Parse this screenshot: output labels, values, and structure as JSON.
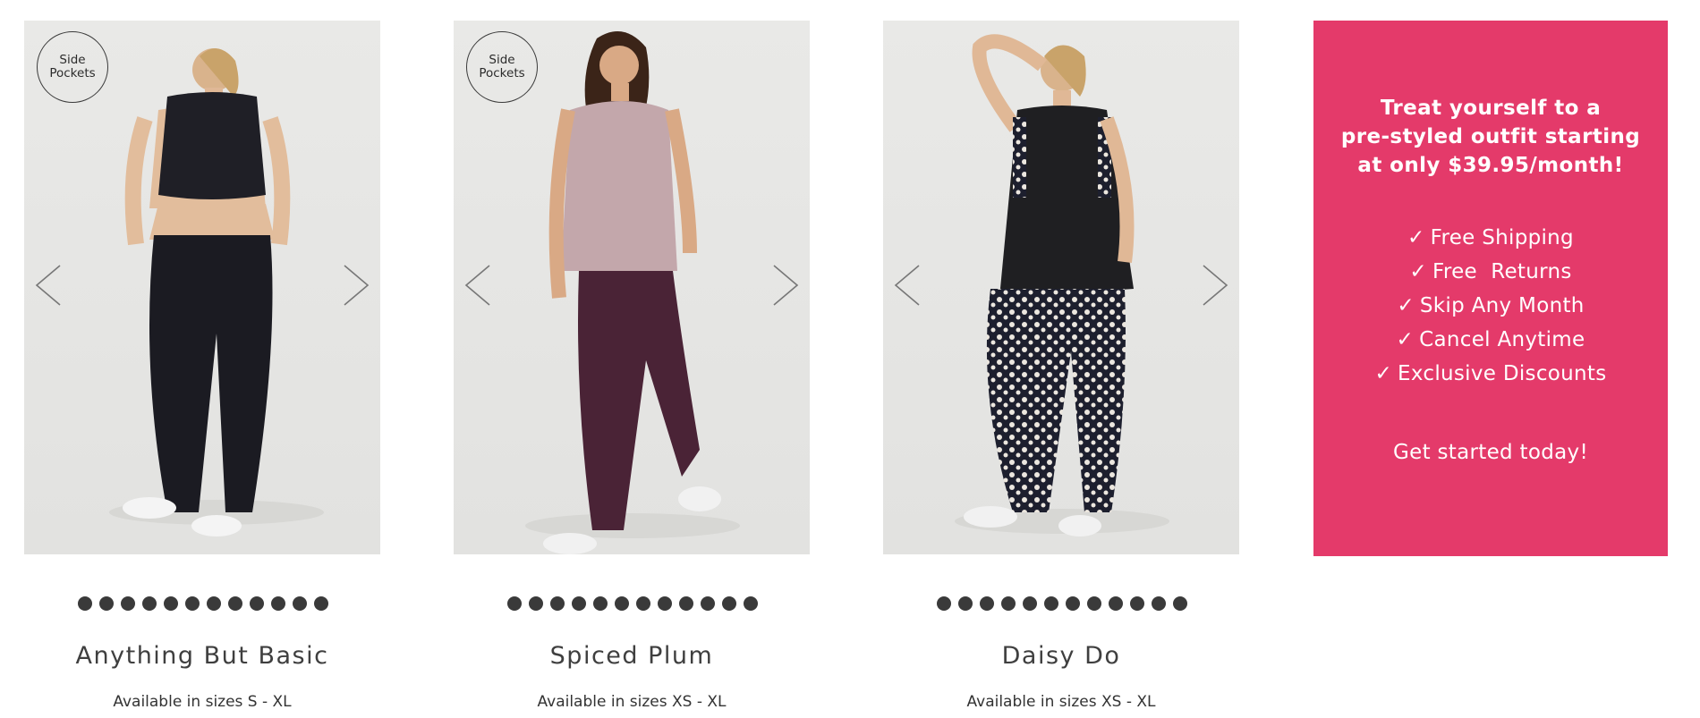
{
  "colors": {
    "promo_bg": "#e43a6a",
    "dot": "#3a3a3a",
    "photo_bg": "#e6e6e4"
  },
  "products": [
    {
      "badge": [
        "Side",
        "Pockets"
      ],
      "name": "Anything But Basic",
      "sizes": "Available in sizes S - XL",
      "dot_count": 12,
      "icons": {
        "prev": "chevron-left-icon",
        "next": "chevron-right-icon"
      }
    },
    {
      "badge": [
        "Side",
        "Pockets"
      ],
      "name": "Spiced Plum",
      "sizes": "Available in sizes XS - XL",
      "dot_count": 12,
      "icons": {
        "prev": "chevron-left-icon",
        "next": "chevron-right-icon"
      }
    },
    {
      "badge": null,
      "name": "Daisy Do",
      "sizes": "Available in sizes XS - XL",
      "dot_count": 12,
      "icons": {
        "prev": "chevron-left-icon",
        "next": "chevron-right-icon"
      }
    }
  ],
  "promo": {
    "headline": [
      "Treat yourself to a",
      "pre-styled outfit starting",
      "at only $39.95/month!"
    ],
    "benefits": [
      "Free Shipping",
      "Free  Returns",
      "Skip Any Month",
      "Cancel Anytime",
      "Exclusive Discounts"
    ],
    "check_glyph": "✓",
    "cta": "Get started today!"
  }
}
